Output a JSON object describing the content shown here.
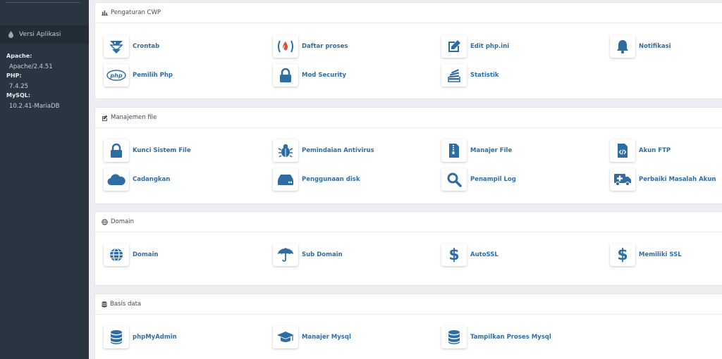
{
  "sidebar": {
    "version_header": "Versi Aplikasi",
    "apache_label": "Apache:",
    "apache_value": "Apache/2.4.51",
    "php_label": "PHP:",
    "php_value": "7.4.25",
    "mysql_label": "MySQL:",
    "mysql_value": "10.2.41-MariaDB"
  },
  "sections": {
    "cwp": {
      "title": "Pengaturan CWP",
      "items": [
        "Crontab",
        "Daftar proses",
        "Edit php.ini",
        "Notifikasi",
        "Pemilih Php",
        "Mod Security",
        "Statistik"
      ]
    },
    "file": {
      "title": "Manajemen file",
      "items": [
        "Kunci Sistem File",
        "Pemindaian Antivirus",
        "Manajer File",
        "Akun FTP",
        "Cadangkan",
        "Penggunaan disk",
        "Penampil Log",
        "Perbaiki Masalah Akun"
      ]
    },
    "domain": {
      "title": "Domain",
      "items": [
        "Domain",
        "Sub Domain",
        "AutoSSL",
        "Memiliki SSL"
      ]
    },
    "db": {
      "title": "Basis data",
      "items": [
        "phpMyAdmin",
        "Manajer Mysql",
        "Tampilkan Proses Mysql"
      ]
    }
  },
  "colors": {
    "icon": "#2e6da4",
    "sidebar_bg": "#2a3542",
    "link": "#2e6da4"
  }
}
